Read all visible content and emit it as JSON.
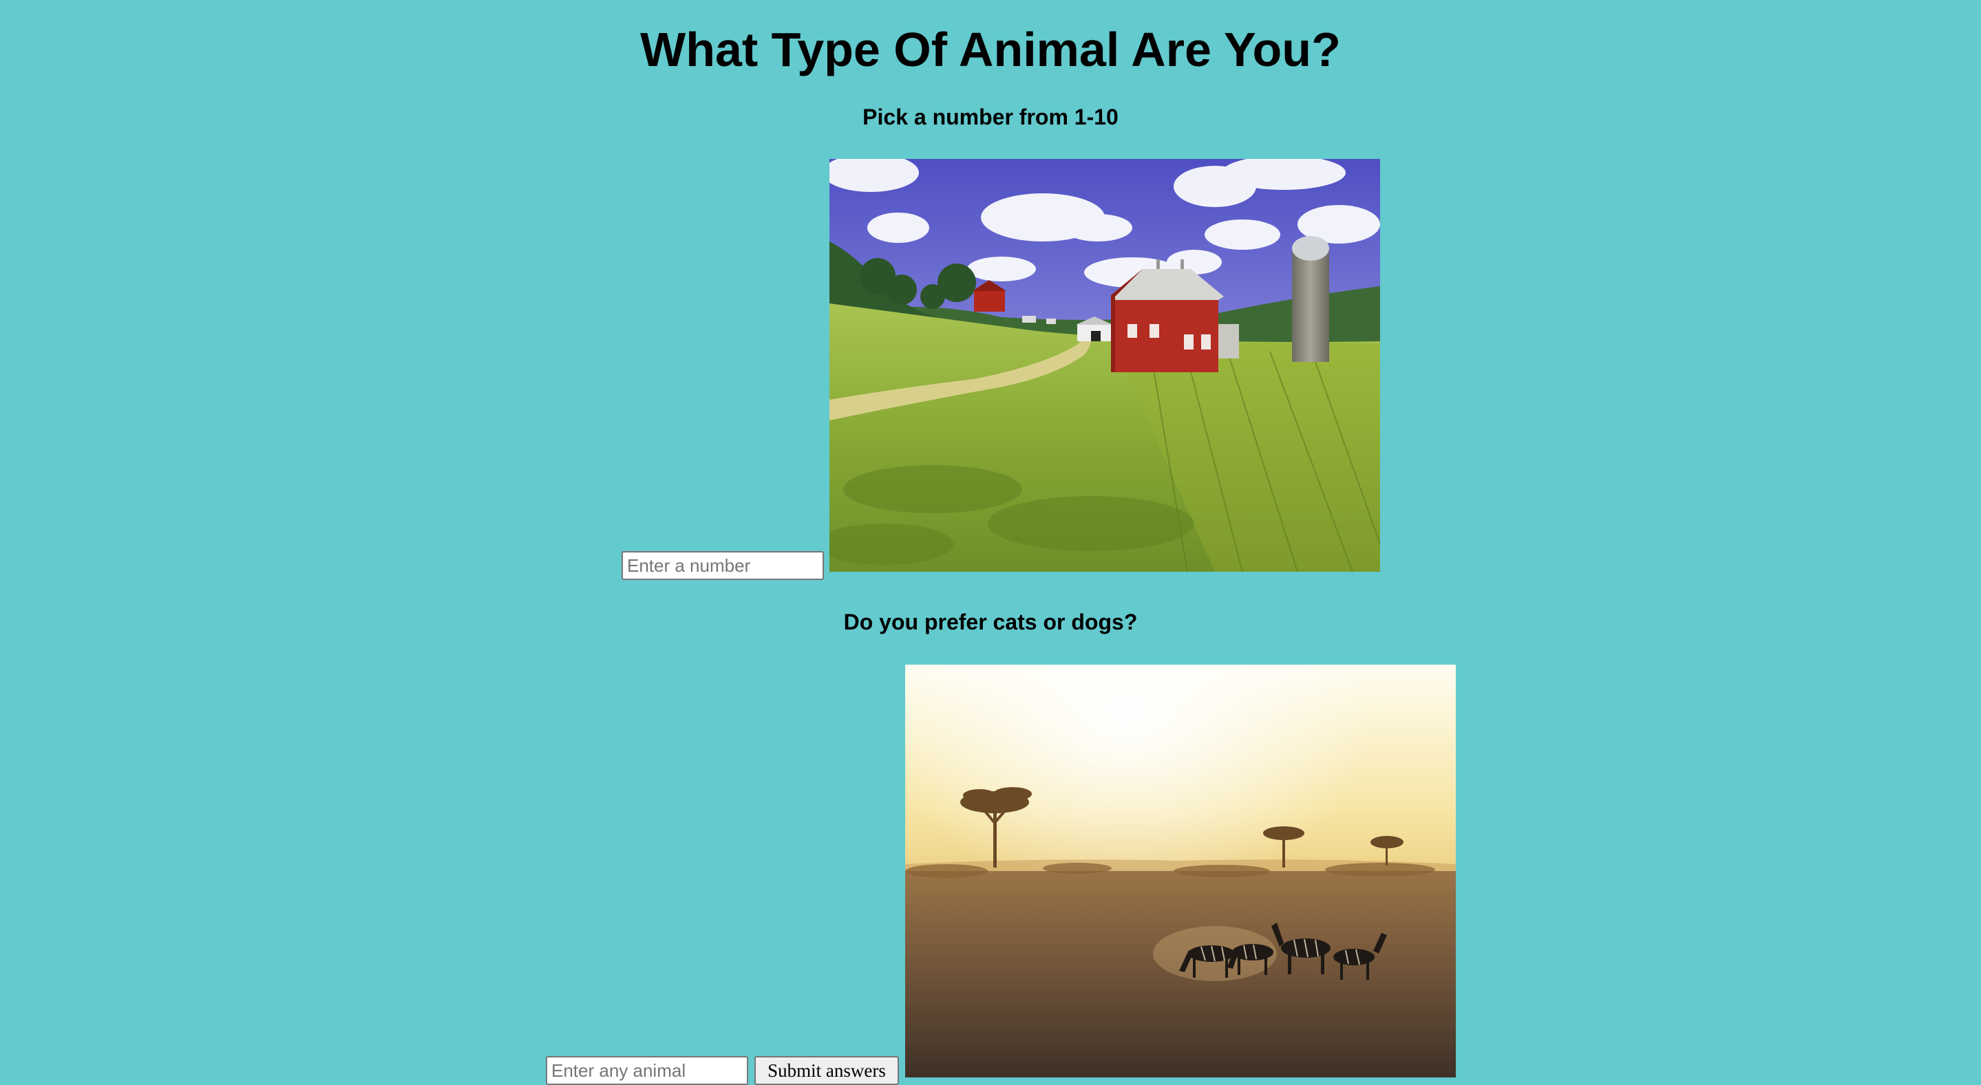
{
  "page": {
    "title": "What Type Of Animal Are You?",
    "background_color": "#63cace"
  },
  "question1": {
    "text": "Pick a number from 1-10",
    "input_placeholder": "Enter a number",
    "image_icon": "farm-landscape-image"
  },
  "question2": {
    "text": "Do you prefer cats or dogs?",
    "input_placeholder": "Enter any animal",
    "image_icon": "savanna-zebras-image"
  },
  "submit": {
    "label": "Submit answers"
  }
}
